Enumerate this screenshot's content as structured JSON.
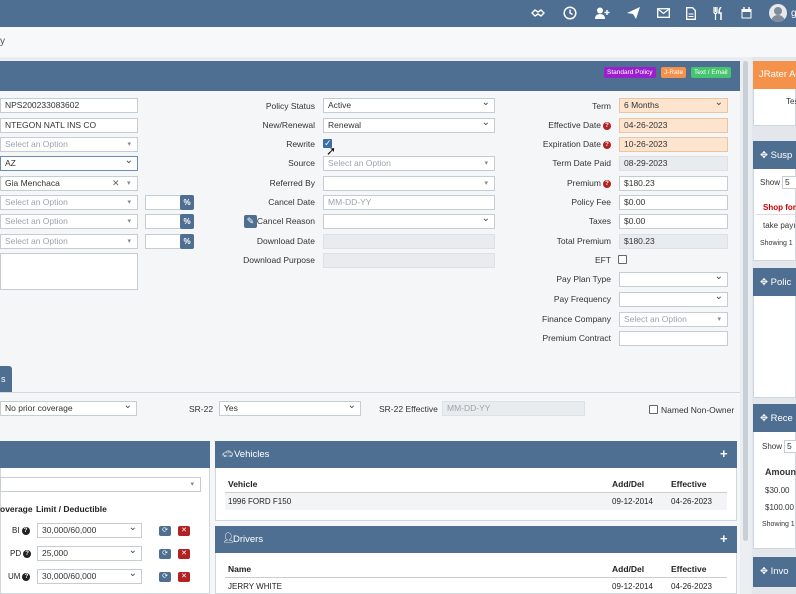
{
  "topbar": {
    "icons": [
      "handshake-icon",
      "clock-icon",
      "add-user-icon",
      "paper-plane-icon",
      "envelope-icon",
      "document-icon",
      "utensils-icon",
      "calendar-icon"
    ],
    "user_initial": "g"
  },
  "breadcrumb": "y",
  "badges": {
    "standard_policy": "Standard Policy",
    "jrate": "J-Rate",
    "text_email": "Text / Email"
  },
  "left_fields": {
    "policy_number": "NPS200233083602",
    "carrier": "NTEGON NATL INS CO",
    "select1": "Select an Option",
    "state": "AZ",
    "agent": "Gia Menchaca",
    "select2": "Select an Option",
    "select3": "Select an Option",
    "select4": "Select an Option",
    "pct": "%"
  },
  "mid_labels": {
    "policy_status": "Policy Status",
    "new_renewal": "New/Renewal",
    "rewrite": "Rewrite",
    "source": "Source",
    "referred_by": "Referred By",
    "cancel_date": "Cancel Date",
    "cancel_reason": "Cancel Reason",
    "download_date": "Download Date",
    "download_purpose": "Download Purpose"
  },
  "mid_values": {
    "policy_status": "Active",
    "new_renewal": "Renewal",
    "source": "Select an Option",
    "cancel_date": "MM-DD-YY"
  },
  "right_labels": {
    "term": "Term",
    "effective_date": "Effective Date",
    "expiration_date": "Expiration Date",
    "term_date_paid": "Term Date Paid",
    "premium": "Premium",
    "policy_fee": "Policy Fee",
    "taxes": "Taxes",
    "total_premium": "Total Premium",
    "eft": "EFT",
    "pay_plan_type": "Pay Plan Type",
    "pay_frequency": "Pay Frequency",
    "finance_company": "Finance Company",
    "premium_contract": "Premium Contract"
  },
  "right_values": {
    "term": "6 Months",
    "effective_date": "04-26-2023",
    "expiration_date": "10-26-2023",
    "term_date_paid": "08-29-2023",
    "premium": "$180.23",
    "policy_fee": "$0.00",
    "taxes": "$0.00",
    "total_premium": "$180.23",
    "finance_company": "Select an Option",
    "info_glyph": "?"
  },
  "tab_stub": "s",
  "prior": {
    "prior_coverage": "No prior coverage",
    "sr22_label": "SR-22",
    "sr22_value": "Yes",
    "sr22_eff_label": "SR-22 Effective",
    "sr22_eff_placeholder": "MM-DD-YY",
    "named_non_owner": "Named Non-Owner"
  },
  "coverage": {
    "col_coverage": "overage",
    "col_limit": "Limit / Deductible",
    "rows": [
      {
        "code": "BI",
        "value": "30,000/60,000"
      },
      {
        "code": "PD",
        "value": "25,000"
      },
      {
        "code": "UM",
        "value": "30,000/60,000"
      }
    ]
  },
  "vehicles": {
    "title": "Vehicles",
    "headers": [
      "Vehicle",
      "Add/Del",
      "Effective"
    ],
    "rows": [
      [
        "1996 FORD F150",
        "09-12-2014",
        "04-26-2023"
      ]
    ]
  },
  "drivers": {
    "title": "Drivers",
    "headers": [
      "Name",
      "Add/Del",
      "Effective"
    ],
    "rows": [
      [
        "JERRY WHITE",
        "09-12-2014",
        "04-26-2023"
      ]
    ]
  },
  "right_panels": {
    "jrater": "JRater Ac",
    "jrater_sub": "Tes",
    "suspense": "Susp",
    "show": "Show",
    "show_value": "5",
    "suspense_item1": "Shop for",
    "suspense_item2": "take payı",
    "showing1": "Showing 1",
    "policy": "Polic",
    "receipts": "Rece",
    "amount_hdr": "Amoun",
    "amount1": "$30.00",
    "amount2": "$100.00",
    "showing2": "Showing 1",
    "invoices": "Invo"
  },
  "colors": {
    "header_blue": "#4e6f91",
    "badge_purple": "#9b1fce",
    "badge_orange": "#f4914b",
    "badge_green": "#46c46f",
    "peach": "#fce4cf",
    "alert_red": "#cc0000"
  }
}
